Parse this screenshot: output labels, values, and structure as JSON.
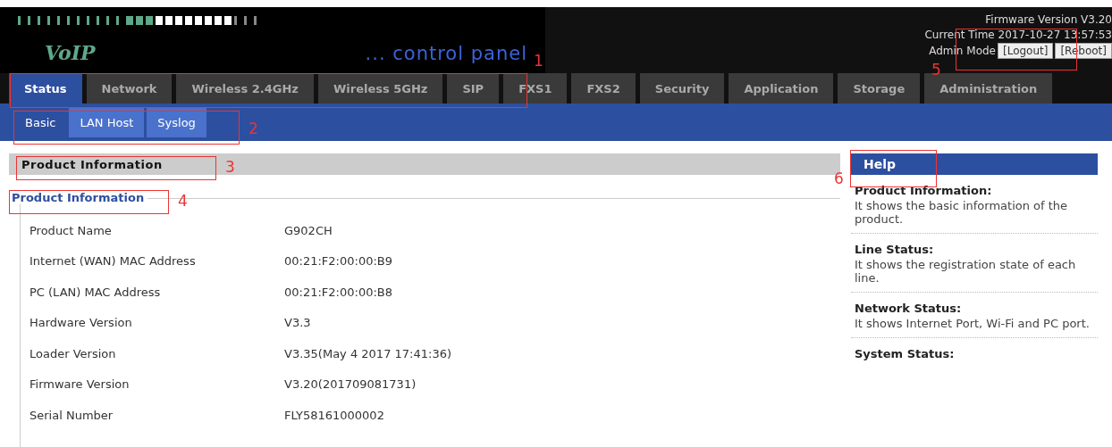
{
  "header": {
    "logo_text": "VoIP",
    "tagline": "... control panel",
    "firmware": "Firmware Version V3.20",
    "current_time": "Current Time 2017-10-27 13:57:53",
    "mode": "Admin Mode",
    "buttons": [
      "[Logout]",
      "[Reboot]"
    ]
  },
  "tabs": [
    {
      "label": "Status",
      "selected": true
    },
    {
      "label": "Network",
      "selected": false
    },
    {
      "label": "Wireless 2.4GHz",
      "selected": false
    },
    {
      "label": "Wireless 5GHz",
      "selected": false
    },
    {
      "label": "SIP",
      "selected": false
    },
    {
      "label": "FXS1",
      "selected": false
    },
    {
      "label": "FXS2",
      "selected": false
    },
    {
      "label": "Security",
      "selected": false
    },
    {
      "label": "Application",
      "selected": false
    },
    {
      "label": "Storage",
      "selected": false
    },
    {
      "label": "Administration",
      "selected": false
    }
  ],
  "subtabs": [
    {
      "label": "Basic",
      "selected": true
    },
    {
      "label": "LAN Host",
      "selected": false
    },
    {
      "label": "Syslog",
      "selected": false
    }
  ],
  "section_title": "Product Information",
  "group_title": "Product Information",
  "rows": [
    {
      "label": "Product Name",
      "value": "G902CH"
    },
    {
      "label": "Internet (WAN) MAC Address",
      "value": "00:21:F2:00:00:B9"
    },
    {
      "label": "PC (LAN) MAC Address",
      "value": "00:21:F2:00:00:B8"
    },
    {
      "label": "Hardware Version",
      "value": "V3.3"
    },
    {
      "label": "Loader Version",
      "value": "V3.35(May 4 2017 17:41:36)"
    },
    {
      "label": "Firmware Version",
      "value": "V3.20(201709081731)"
    },
    {
      "label": "Serial Number",
      "value": "FLY58161000002"
    }
  ],
  "help": {
    "title": "Help",
    "items": [
      {
        "heading": "Product Information:",
        "text": "It shows the basic information of the product."
      },
      {
        "heading": "Line Status:",
        "text": "It shows the registration state of each line."
      },
      {
        "heading": "Network Status:",
        "text": "It shows Internet Port, Wi-Fi and PC port."
      },
      {
        "heading": "System Status:"
      }
    ]
  },
  "callouts": [
    {
      "label": "1"
    },
    {
      "label": "2"
    },
    {
      "label": "3"
    },
    {
      "label": "4"
    },
    {
      "label": "5"
    },
    {
      "label": "6"
    }
  ]
}
